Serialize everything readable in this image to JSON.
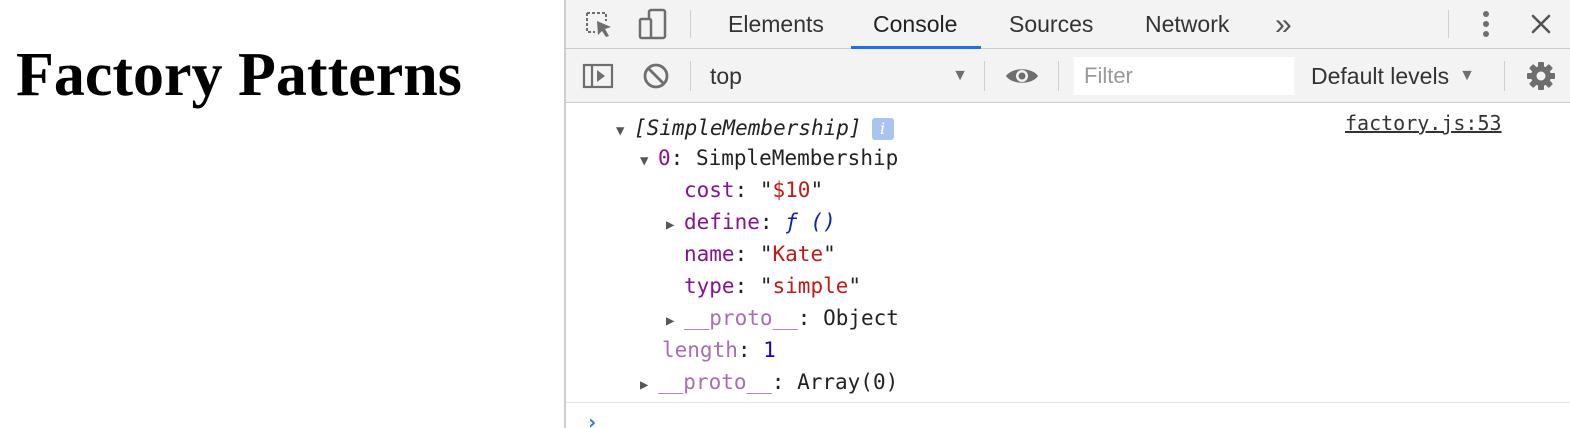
{
  "page": {
    "heading": "Factory Patterns"
  },
  "devtools": {
    "tabs": {
      "elements": "Elements",
      "console": "Console",
      "sources": "Sources",
      "network": "Network",
      "more": "»"
    },
    "toolbar": {
      "context": "top",
      "filter_placeholder": "Filter",
      "levels": "Default levels"
    },
    "console": {
      "source_link": "factory.js:53",
      "array_label": "[SimpleMembership]",
      "info_badge": "i",
      "item_index": "0",
      "item_type": "SimpleMembership",
      "props": {
        "cost_key": "cost",
        "cost_val": "$10",
        "define_key": "define",
        "define_val": "ƒ ()",
        "name_key": "name",
        "name_val": "Kate",
        "type_key": "type",
        "type_val": "simple",
        "proto_key": "__proto__",
        "proto_val": "Object"
      },
      "length_key": "length",
      "length_val": "1",
      "array_proto_key": "__proto__",
      "array_proto_val": "Array(0)",
      "prompt": "›"
    },
    "icons": [
      "inspect-icon",
      "device-toggle-icon",
      "more-vertical-icon",
      "close-icon",
      "sidebar-toggle-icon",
      "clear-console-icon",
      "eye-icon",
      "gear-icon"
    ],
    "colors": {
      "accent": "#1a73e8",
      "key": "#881391",
      "string": "#c41a16",
      "number": "#1c00cf"
    }
  }
}
